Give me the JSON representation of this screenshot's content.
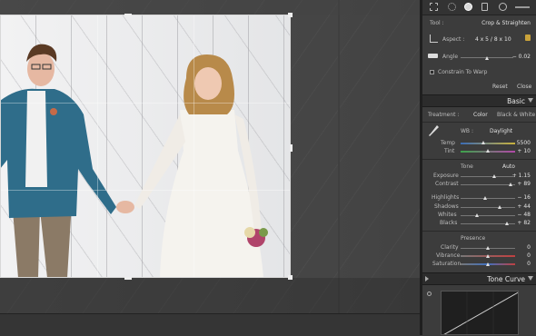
{
  "crop_tool": {
    "tool_label": "Tool :",
    "tool_name": "Crop & Straighten",
    "aspect_label": "Aspect :",
    "aspect_value": "4 x 5  /  8 x 10",
    "angle_label": "Angle",
    "angle_value": "− 0.02",
    "constrain_label": "Constrain To Warp",
    "reset_label": "Reset",
    "close_label": "Close"
  },
  "basic": {
    "title": "Basic",
    "treatment_label": "Treatment :",
    "color_option": "Color",
    "bw_option": "Black & White",
    "wb_label": "WB :",
    "wb_value": "Daylight",
    "temp_label": "Temp",
    "temp_value": "5500",
    "tint_label": "Tint",
    "tint_value": "+ 10",
    "tone_label": "Tone",
    "auto_label": "Auto",
    "exposure_label": "Exposure",
    "exposure_value": "+ 1.15",
    "contrast_label": "Contrast",
    "contrast_value": "+ 89",
    "highlights_label": "Highlights",
    "highlights_value": "− 16",
    "shadows_label": "Shadows",
    "shadows_value": "+ 44",
    "whites_label": "Whites",
    "whites_value": "− 48",
    "blacks_label": "Blacks",
    "blacks_value": "+ 82",
    "presence_label": "Presence",
    "clarity_label": "Clarity",
    "clarity_value": "0",
    "vibrance_label": "Vibrance",
    "vibrance_value": "0",
    "saturation_label": "Saturation",
    "saturation_value": "0"
  },
  "tone_curve": {
    "title": "Tone Curve"
  },
  "sliders": {
    "angle": 0.5,
    "temp": 0.42,
    "tint": 0.5,
    "exposure": 0.62,
    "contrast": 0.92,
    "highlights": 0.46,
    "shadows": 0.72,
    "whites": 0.3,
    "blacks": 0.86,
    "clarity": 0.5,
    "vibrance": 0.5,
    "saturation": 0.5
  },
  "colors": {
    "panel_bg": "#3c3c3c",
    "header_bg": "#2c2c2c",
    "accent": "#e6e6e6"
  }
}
